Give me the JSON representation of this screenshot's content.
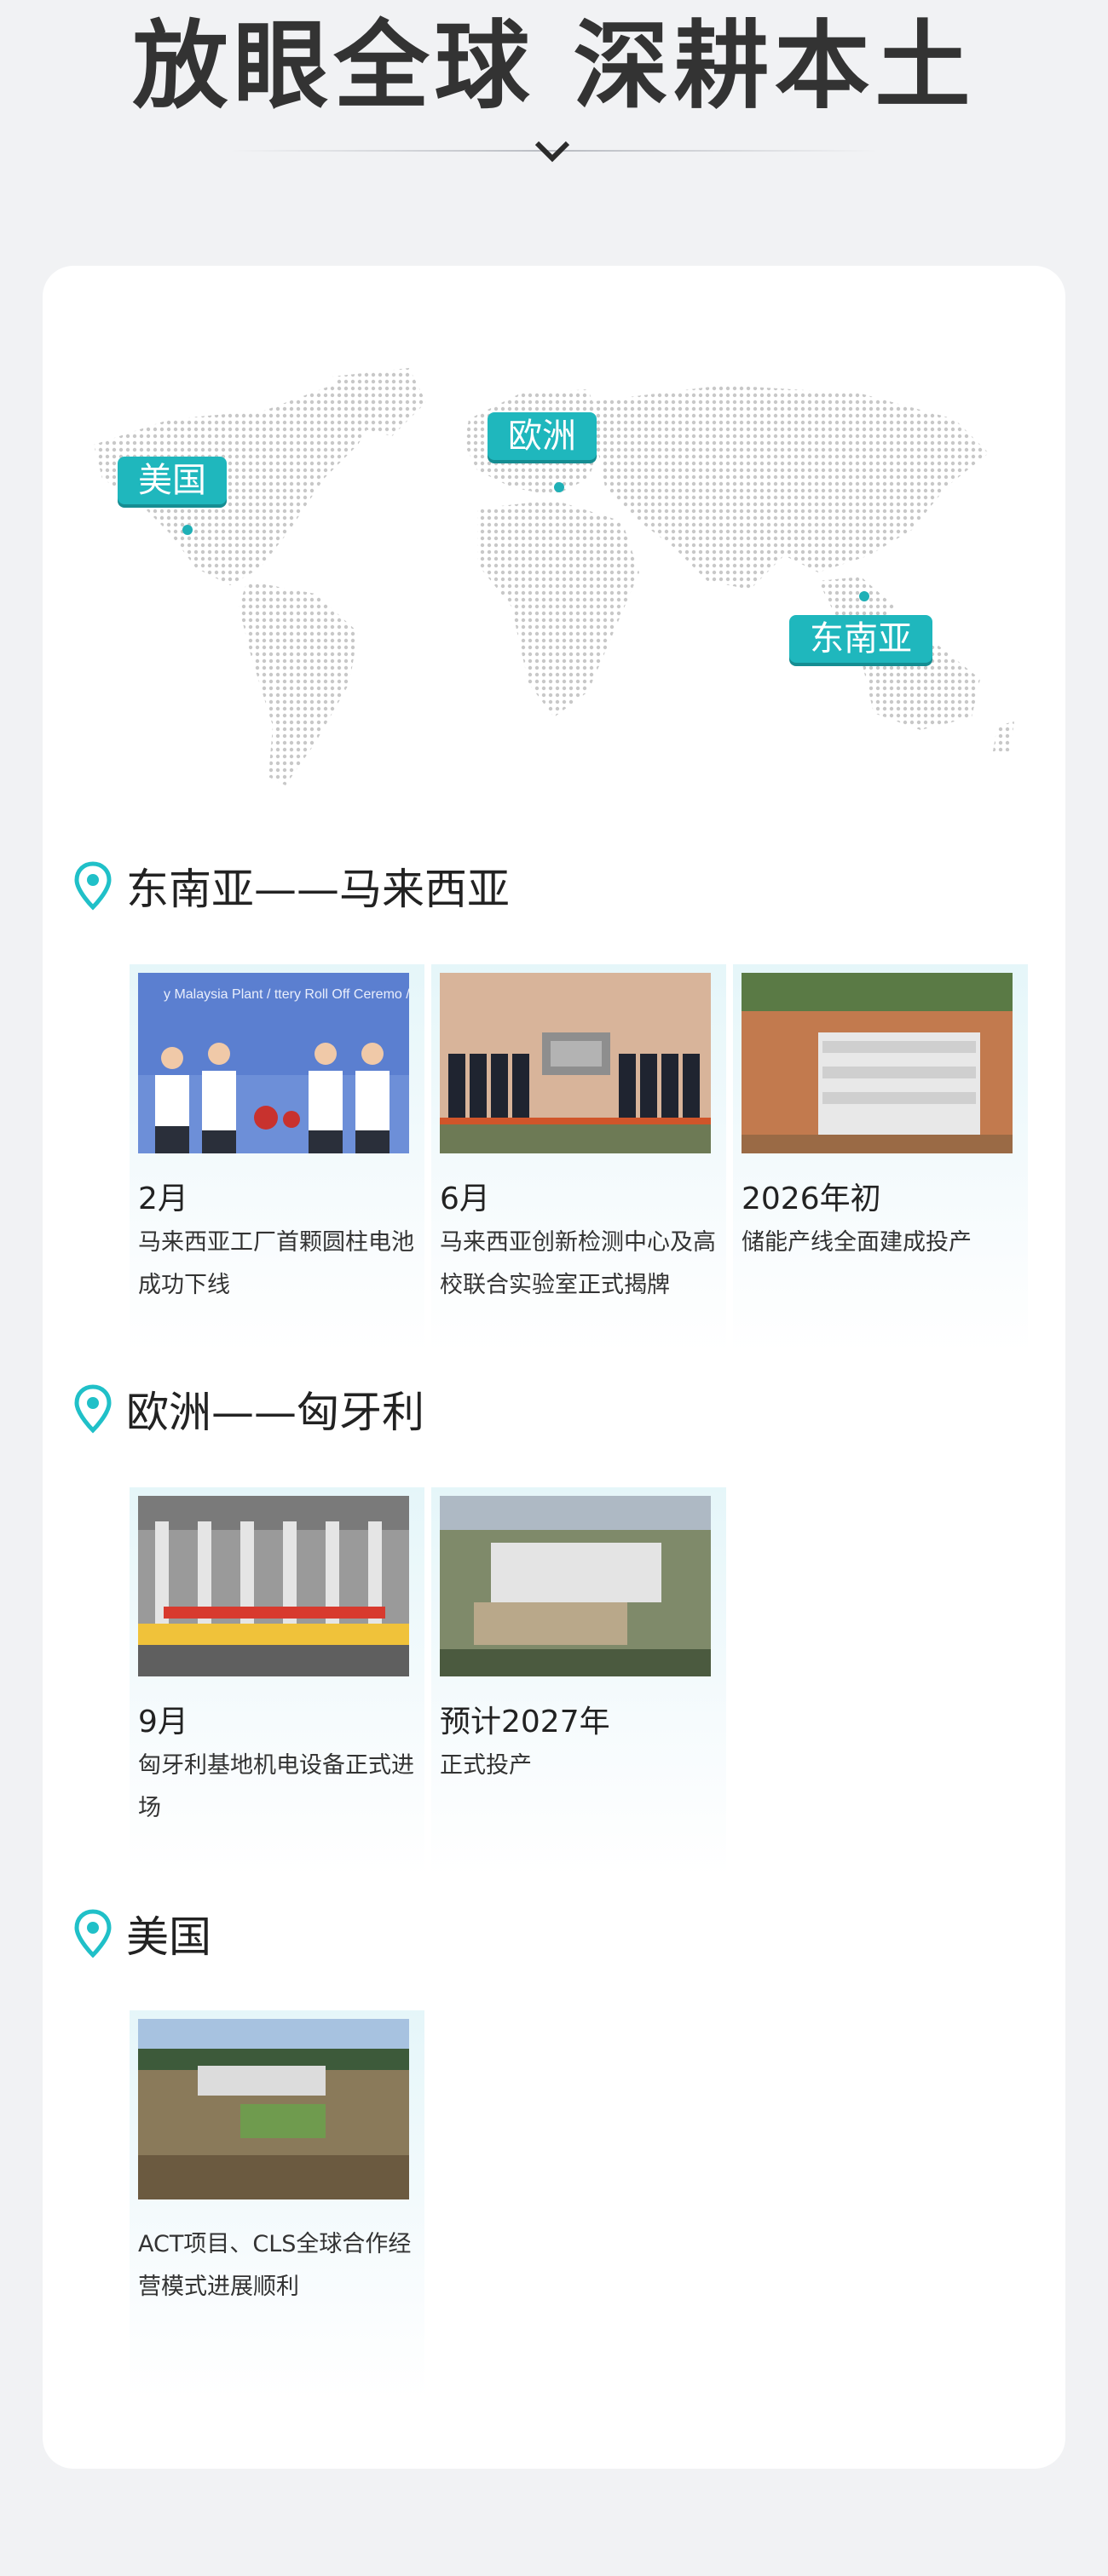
{
  "header": {
    "title": "放眼全球 深耕本土"
  },
  "map": {
    "labels": {
      "usa": "美国",
      "europe": "欧洲",
      "sea": "东南亚"
    },
    "accent": "#1fb7bd"
  },
  "sections": [
    {
      "title": "东南亚——马来西亚",
      "items": [
        {
          "month": "2月",
          "desc": "马来西亚工厂首颗圆柱电池成功下线",
          "photo_text": "y Malaysia Plant / ttery Roll Off Ceremo / 下线仪式"
        },
        {
          "month": "6月",
          "desc": "马来西亚创新检测中心及高校联合实验室正式揭牌"
        },
        {
          "month": "2026年初",
          "desc": "储能产线全面建成投产"
        }
      ]
    },
    {
      "title": "欧洲——匈牙利",
      "items": [
        {
          "month": "9月",
          "desc": "匈牙利基地机电设备正式进场"
        },
        {
          "month": "预计2027年",
          "desc": "正式投产"
        }
      ]
    },
    {
      "title": "美国",
      "items": [
        {
          "month": "",
          "desc": "ACT项目、CLS全球合作经营模式进展顺利"
        }
      ]
    }
  ],
  "icons": {
    "pin": "location-pin-icon",
    "chevron": "chevron-down-icon"
  }
}
